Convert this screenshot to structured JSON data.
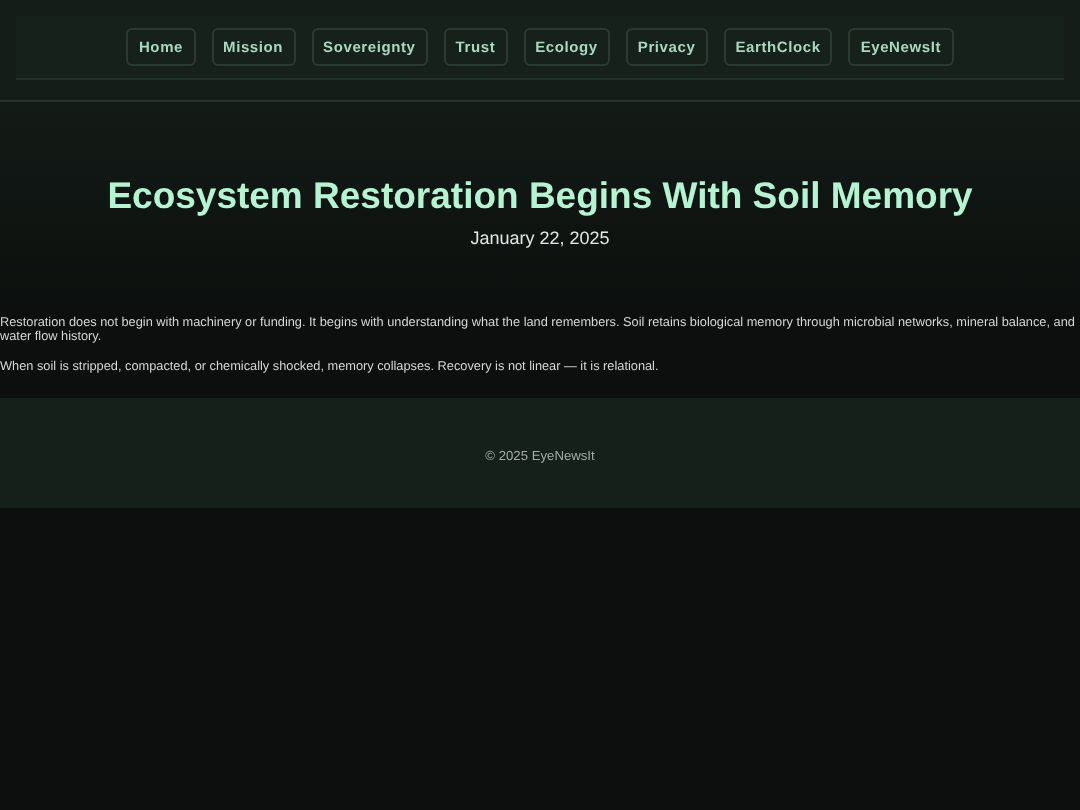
{
  "nav": {
    "links": [
      {
        "label": "Home"
      },
      {
        "label": "Mission"
      },
      {
        "label": "Sovereignty"
      },
      {
        "label": "Trust"
      },
      {
        "label": "Ecology"
      },
      {
        "label": "Privacy"
      },
      {
        "label": "EarthClock"
      },
      {
        "label": "EyeNewsIt"
      }
    ]
  },
  "header": {
    "title": "Ecosystem Restoration Begins With Soil Memory",
    "date": "January 22, 2025"
  },
  "article": {
    "paragraphs": [
      "Restoration does not begin with machinery or funding. It begins with understanding what the land remembers. Soil retains biological memory through microbial networks, mineral balance, and water flow history.",
      "When soil is stripped, compacted, or chemically shocked, memory collapses. Recovery is not linear — it is relational."
    ]
  },
  "footer": {
    "text": "© 2025 EyeNewsIt"
  }
}
